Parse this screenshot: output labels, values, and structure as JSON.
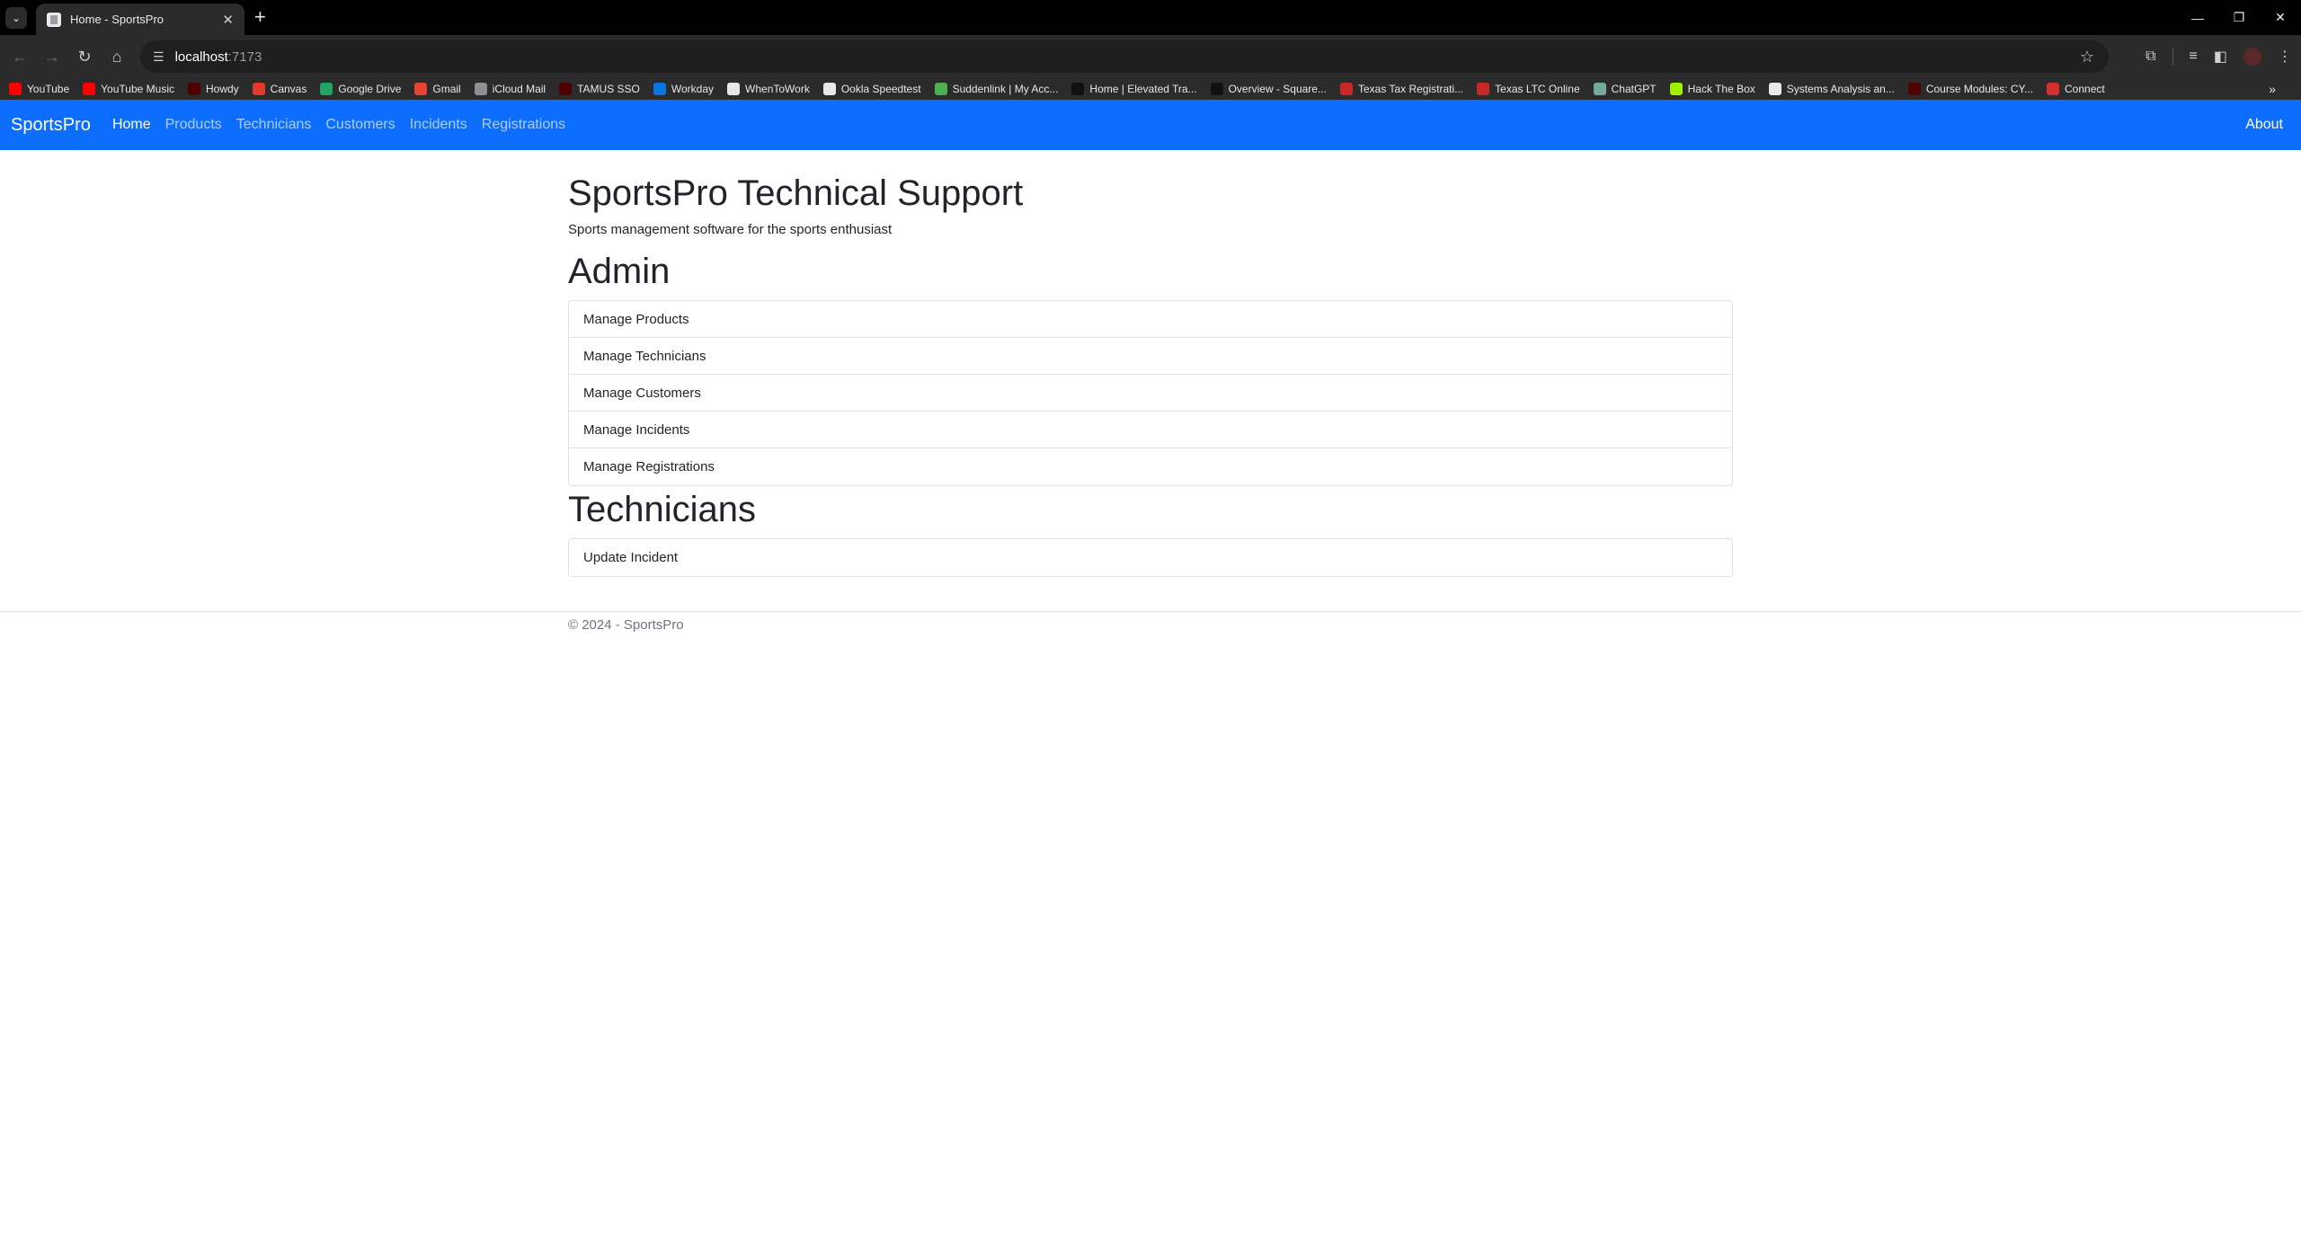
{
  "browser": {
    "tab_title": "Home - SportsPro",
    "new_tab_icon": "plus-icon",
    "url_host": "localhost",
    "url_port": ":7173",
    "bookmarks": [
      {
        "label": "YouTube",
        "color": "#ff0000"
      },
      {
        "label": "YouTube Music",
        "color": "#ff0000"
      },
      {
        "label": "Howdy",
        "color": "#500000"
      },
      {
        "label": "Canvas",
        "color": "#e23b2e"
      },
      {
        "label": "Google Drive",
        "color": "#1fa463"
      },
      {
        "label": "Gmail",
        "color": "#ea4335"
      },
      {
        "label": "iCloud Mail",
        "color": "#8e8e93"
      },
      {
        "label": "TAMUS SSO",
        "color": "#500000"
      },
      {
        "label": "Workday",
        "color": "#0875e1"
      },
      {
        "label": "WhenToWork",
        "color": "#e8e8e8"
      },
      {
        "label": "Ookla Speedtest",
        "color": "#e8e8e8"
      },
      {
        "label": "Suddenlink | My Acc...",
        "color": "#4caf50"
      },
      {
        "label": "Home | Elevated Tra...",
        "color": "#111111"
      },
      {
        "label": "Overview - Square...",
        "color": "#111111"
      },
      {
        "label": "Texas Tax Registrati...",
        "color": "#c62828"
      },
      {
        "label": "Texas LTC Online",
        "color": "#c62828"
      },
      {
        "label": "ChatGPT",
        "color": "#74aa9c"
      },
      {
        "label": "Hack The Box",
        "color": "#9fef00"
      },
      {
        "label": "Systems Analysis an...",
        "color": "#e8e8e8"
      },
      {
        "label": "Course Modules: CY...",
        "color": "#500000"
      },
      {
        "label": "Connect",
        "color": "#d32f2f"
      }
    ]
  },
  "navbar": {
    "brand": "SportsPro",
    "links": [
      "Home",
      "Products",
      "Technicians",
      "Customers",
      "Incidents",
      "Registrations"
    ],
    "active": "Home",
    "about": "About",
    "color": "#0d6efd"
  },
  "main": {
    "title": "SportsPro Technical Support",
    "subtitle": "Sports management software for the sports enthusiast",
    "admin_heading": "Admin",
    "admin_links": [
      "Manage Products",
      "Manage Technicians",
      "Manage Customers",
      "Manage Incidents",
      "Manage Registrations"
    ],
    "technicians_heading": "Technicians",
    "technician_links": [
      "Update Incident"
    ]
  },
  "footer": {
    "text": "© 2024 - SportsPro"
  }
}
